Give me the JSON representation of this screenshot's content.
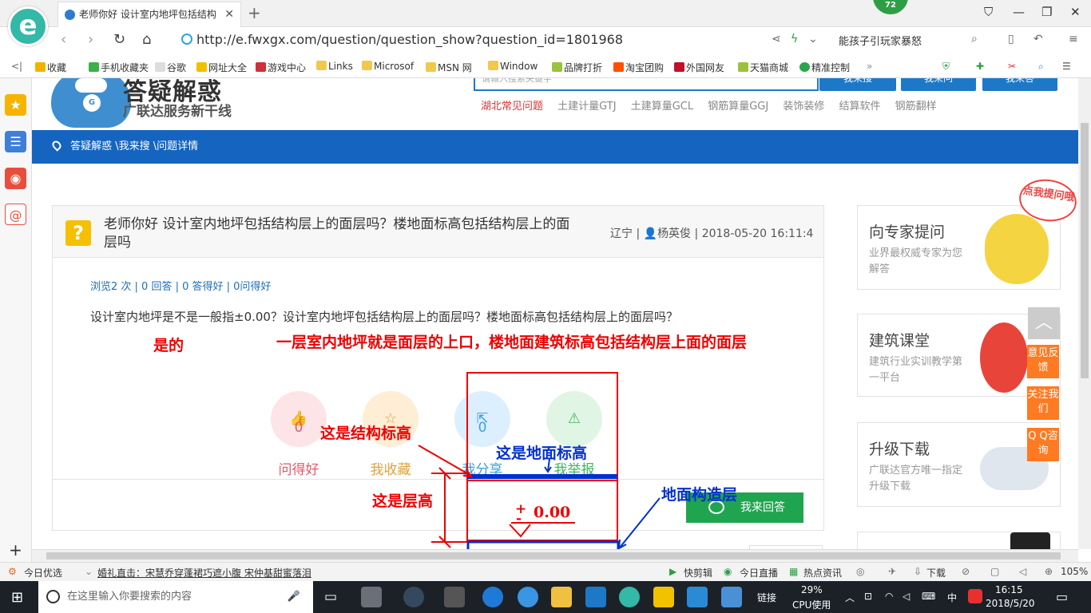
{
  "browser": {
    "tab_title": "老师你好 设计室内地坪包括结构",
    "tab_close": "✕",
    "new_tab": "+",
    "badge_count": "72",
    "logo_letter": "e",
    "url": "http://e.fwxgx.com/question/question_show?question_id=1801968",
    "search_text": "能孩子引玩家暴怒",
    "favorites": [
      {
        "label": "收藏",
        "color": "#f2b200"
      },
      {
        "label": "手机收藏夹",
        "color": "#3cb04a"
      },
      {
        "label": "谷歌",
        "color": "#bbbbbb"
      },
      {
        "label": "网址大全",
        "color": "#f0c000"
      },
      {
        "label": "游戏中心",
        "color": "#d0303a"
      },
      {
        "label": "Links",
        "color": "#f2c84b"
      },
      {
        "label": "Microsof",
        "color": "#f2c84b"
      },
      {
        "label": "MSN 网",
        "color": "#f2c84b"
      },
      {
        "label": "Window",
        "color": "#f2c84b"
      },
      {
        "label": "品牌打折",
        "color": "#9ac23c"
      },
      {
        "label": "淘宝团购",
        "color": "#ff5000"
      },
      {
        "label": "外国网友",
        "color": "#c0102a"
      },
      {
        "label": "天猫商城",
        "color": "#9ac23c"
      },
      {
        "label": "精准控制",
        "color": "#2aa64a"
      }
    ]
  },
  "header": {
    "site_title": "答疑解惑",
    "site_subtitle": "广联达服务新干线",
    "search_placeholder": "请输入搜索关键字",
    "search_buttons": [
      "我来搜",
      "我来问",
      "我来答"
    ],
    "hot_links": [
      "湖北常见问题",
      "土建计量GTJ",
      "土建算量GCL",
      "钢筋算量GGJ",
      "装饰装修",
      "结算软件",
      "钢筋翻样"
    ]
  },
  "breadcrumb": "答疑解惑 \\我来搜 \\问题详情",
  "question": {
    "title": "老师你好 设计室内地坪包括结构层上的面层吗？楼地面标高包括结构层上的面层吗",
    "region": "辽宁",
    "author": "杨英俊",
    "time": "2018-05-20 16:11:4",
    "stats": "浏览2 次 | 0 回答 | 0 答得好 | 0问得好",
    "body": "设计室内地坪是不是一般指±0.00？设计室内地坪包括结构层上的面层吗？楼地面标高包括结构层上的面层吗？"
  },
  "actions": [
    {
      "label": "问得好",
      "count": "0",
      "color": "#e25a6b",
      "bg": "#fde4e6"
    },
    {
      "label": "我收藏",
      "count": "",
      "color": "#e0a23a",
      "bg": "#fdeed5"
    },
    {
      "label": "我分享",
      "count": "0",
      "color": "#3aa1e0",
      "bg": "#dcefff"
    },
    {
      "label": "我举报",
      "count": "",
      "color": "#3fb75a",
      "bg": "#e0f5e4"
    }
  ],
  "answer_button": "我来回答",
  "right": {
    "cards": [
      {
        "title": "向专家提问",
        "sub": "业界最权威专家为您解答"
      },
      {
        "title": "建筑课堂",
        "sub": "建筑行业实训教学第一平台"
      },
      {
        "title": "升级下载",
        "sub": "广联达官方唯一指定升级下载"
      }
    ],
    "speech": "点我提问哦",
    "float_buttons": [
      "意见反馈",
      "关注我们",
      "Q Q咨询"
    ]
  },
  "annotations": {
    "yes": "是的",
    "answer": "一层室内地坪就是面层的上口，楼地面建筑标高包括结构层上面的面层",
    "structure_elev": "这是结构标高",
    "floor_elev": "这是地面标高",
    "floor_layer": "地面构造层",
    "story_height": "这是层高",
    "plus": "+",
    "zero": "0.00",
    "minus": "-"
  },
  "statusbar": {
    "left_items": [
      "今日优选",
      "婚礼直击：宋慧乔穿蓬裙巧遮小腹 宋仲基甜蜜落泪"
    ],
    "right_items": [
      "快剪辑",
      "今日直播",
      "热点资讯",
      "下载"
    ],
    "zoom": "105%"
  },
  "taskbar": {
    "search_placeholder": "在这里输入你要搜索的内容",
    "link_label": "链接",
    "cpu_percent": "29%",
    "cpu_label": "CPU使用",
    "ime": "中",
    "time": "16:15",
    "date": "2018/5/20"
  }
}
